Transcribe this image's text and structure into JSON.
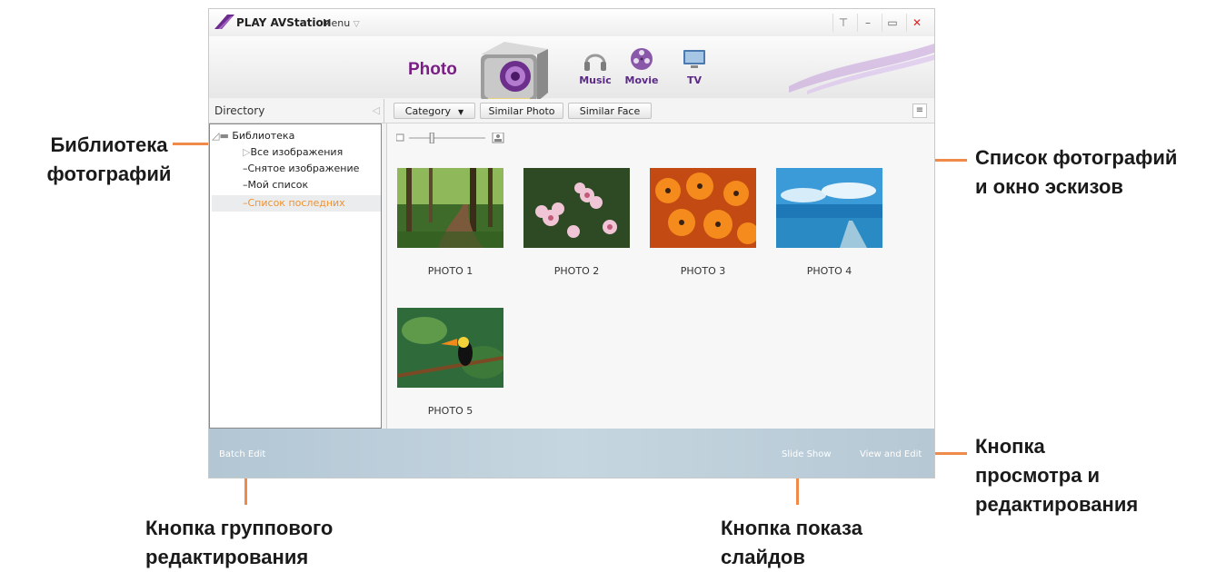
{
  "app": {
    "title": "PLAY AVStation",
    "menu_label": "Menu",
    "menu_caret": "▽",
    "window_controls": [
      "popup-icon",
      "minimize-icon",
      "maximize-icon",
      "close-icon"
    ]
  },
  "banner": {
    "current_mode": "Photo",
    "tabs": [
      {
        "label": "Music",
        "icon": "headphones-icon"
      },
      {
        "label": "Movie",
        "icon": "film-reel-icon"
      },
      {
        "label": "TV",
        "icon": "tv-icon"
      }
    ]
  },
  "directory": {
    "title": "Directory",
    "root": "Библиотека",
    "items": [
      {
        "label": "Все изображения",
        "marker": "▷"
      },
      {
        "label": "Снятое изображение",
        "marker": "–"
      },
      {
        "label": "Мой список",
        "marker": "–"
      },
      {
        "label": "Список последних",
        "marker": "–"
      }
    ]
  },
  "toolbar": {
    "category_label": "Category",
    "category_caret": "▼",
    "similar_photo_label": "Similar Photo",
    "similar_face_label": "Similar Face",
    "list_view_icon": "list-view-icon"
  },
  "zoom": {
    "level": 0.3
  },
  "photos": [
    {
      "label": "PHOTO 1"
    },
    {
      "label": "PHOTO 2"
    },
    {
      "label": "PHOTO 3"
    },
    {
      "label": "PHOTO 4"
    },
    {
      "label": "PHOTO 5"
    }
  ],
  "bottom": {
    "batch_edit_label": "Batch Edit",
    "slide_show_label": "Slide Show",
    "view_edit_label": "View and Edit"
  },
  "callouts": {
    "library": [
      "Библиотека",
      "фотографий"
    ],
    "photo_list": [
      "Список фотографий",
      "и окно эскизов"
    ],
    "view_edit": [
      "Кнопка",
      "просмотра и",
      "редактирования"
    ],
    "batch_edit": [
      "Кнопка группового",
      "редактирования"
    ],
    "slide_show": [
      "Кнопка показа",
      "слайдов"
    ]
  },
  "colors": {
    "accent_orange": "#f08a4b",
    "selected_item": "#f2922d",
    "photo_label": "#7a1e86",
    "bottom_bar": "#b8cbd8"
  }
}
